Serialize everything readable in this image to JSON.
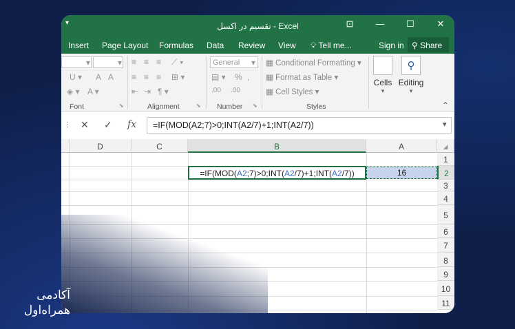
{
  "window": {
    "title": "تقسيم در اكسل - Excel",
    "minimize_icon": "minimize-icon",
    "maximize_icon": "maximize-icon",
    "close_icon": "close-icon"
  },
  "tabs": [
    "Insert",
    "Page Layout",
    "Formulas",
    "Data",
    "Review",
    "View"
  ],
  "tell_me": "Tell me...",
  "sign_in": "Sign in",
  "share": "Share",
  "ribbon": {
    "font_group": "Font",
    "alignment_group": "Alignment",
    "number_group": "Number",
    "styles_group": "Styles",
    "number_format": "General",
    "conditional_formatting": "Conditional Formatting",
    "format_as_table": "Format as Table",
    "cell_styles": "Cell Styles",
    "cells": "Cells",
    "editing": "Editing"
  },
  "formula_bar": {
    "cancel_glyph": "✕",
    "enter_glyph": "✓",
    "fx_label": "fx",
    "formula": "=IF(MOD(A2;7)>0;INT(A2/7)+1;INT(A2/7))"
  },
  "columns": [
    "D",
    "C",
    "B",
    "A"
  ],
  "rows": [
    "1",
    "2",
    "3",
    "4",
    "5",
    "6",
    "7",
    "8",
    "9",
    "10",
    "11"
  ],
  "cells": {
    "a2": "16",
    "b2_parts": [
      "=IF(MOD(",
      "A2",
      ";7)>0;INT(",
      "A2",
      "/7)+1;INT(",
      "A2",
      "/7))"
    ]
  },
  "logo": {
    "line1": "آکادمی",
    "line2": "همراه‌اول"
  },
  "colors": {
    "excel_green": "#217346",
    "background": "#0f1f4a",
    "selection": "#c5d4ea",
    "reference_blue": "#3a6fc4"
  }
}
